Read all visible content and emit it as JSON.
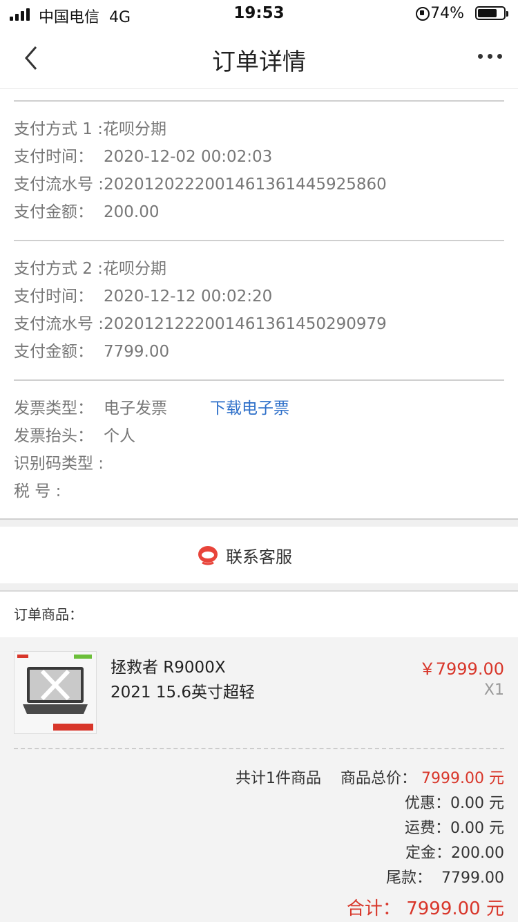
{
  "status_bar": {
    "carrier": "中国电信",
    "network": "4G",
    "time": "19:53",
    "battery_percent": "74%",
    "battery_level": 0.74
  },
  "nav": {
    "title": "订单详情"
  },
  "payments": [
    {
      "method_label": "支付方式 1 :",
      "method_value": "花呗分期",
      "time_label": "支付时间：",
      "time_value": "2020-12-02 00:02:03",
      "serial_label": "支付流水号 :",
      "serial_value": "2020120222001461361445925860",
      "amount_label": "支付金额：",
      "amount_value": "200.00"
    },
    {
      "method_label": "支付方式 2 :",
      "method_value": "花呗分期",
      "time_label": "支付时间：",
      "time_value": "2020-12-12 00:02:20",
      "serial_label": "支付流水号 :",
      "serial_value": "2020121222001461361450290979",
      "amount_label": "支付金额：",
      "amount_value": "7799.00"
    }
  ],
  "invoice": {
    "type_label": "发票类型：",
    "type_value": "电子发票",
    "download_link": "下载电子票",
    "header_label": "发票抬头：",
    "header_value": "个人",
    "idcode_label": "识别码类型 :",
    "tax_label": "税 号 :"
  },
  "service": {
    "label": "联系客服"
  },
  "goods": {
    "title": "订单商品：",
    "product_line1": "拯救者 R9000X",
    "product_line2": "2021 15.6英寸超轻",
    "price": "￥7999.00",
    "qty": "X1",
    "count_text": "共计1件商品",
    "total_label": "商品总价：",
    "total_value": "7999.00 元",
    "discount_label": "优惠：",
    "discount_value": "0.00 元",
    "shipping_label": "运费：",
    "shipping_value": "0.00 元",
    "deposit_label": "定金：",
    "deposit_value": "200.00",
    "balance_label": "尾款：",
    "balance_value": "7799.00",
    "grand_label": "合计：",
    "grand_value": "7999.00 元"
  },
  "colors": {
    "price_red": "#d8362a",
    "link_blue": "#2d6fc9"
  }
}
